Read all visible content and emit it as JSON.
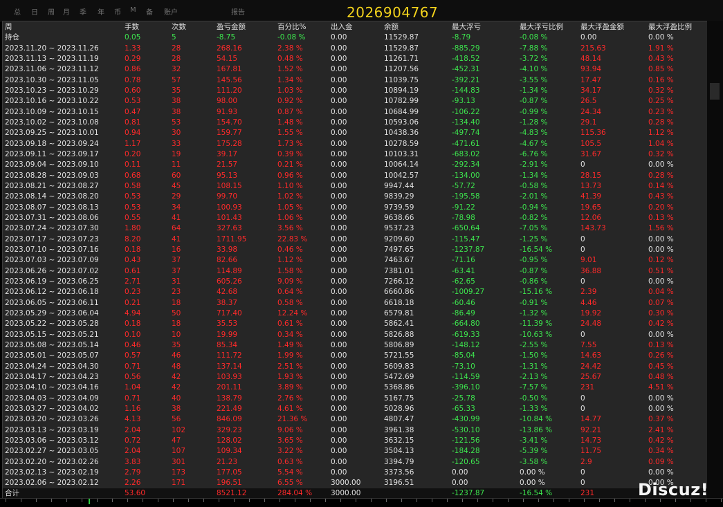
{
  "toolbar": {
    "tabs": [
      "总",
      "日",
      "周",
      "月",
      "季",
      "年",
      "币",
      "M",
      "备",
      "账户",
      "报告"
    ]
  },
  "watermark_id": "2026904767",
  "logo": "Discuz!",
  "table": {
    "columns": [
      "周",
      "手数",
      "次数",
      "盈亏金额",
      "百分比%",
      "出入金",
      "余额",
      "最大浮亏",
      "最大浮亏比例",
      "最大浮盈金额",
      "最大浮盈比例"
    ],
    "holding": [
      "持仓",
      "0.05",
      "5",
      "-8.75",
      "-0.08 %",
      "0.00",
      "11529.87",
      "-8.79",
      "-0.08 %",
      "0.00",
      "0.00 %"
    ],
    "rows": [
      [
        "2023.11.20 ~ 2023.11.26",
        "1.33",
        "28",
        "268.16",
        "2.38 %",
        "0.00",
        "11529.87",
        "-885.29",
        "-7.88 %",
        "215.63",
        "1.91 %"
      ],
      [
        "2023.11.13 ~ 2023.11.19",
        "0.29",
        "28",
        "54.15",
        "0.48 %",
        "0.00",
        "11261.71",
        "-418.52",
        "-3.72 %",
        "48.14",
        "0.43 %"
      ],
      [
        "2023.11.06 ~ 2023.11.12",
        "0.86",
        "32",
        "167.81",
        "1.52 %",
        "0.00",
        "11207.56",
        "-452.31",
        "-4.10 %",
        "93.94",
        "0.85 %"
      ],
      [
        "2023.10.30 ~ 2023.11.05",
        "0.78",
        "57",
        "145.56",
        "1.34 %",
        "0.00",
        "11039.75",
        "-392.21",
        "-3.55 %",
        "17.47",
        "0.16 %"
      ],
      [
        "2023.10.23 ~ 2023.10.29",
        "0.60",
        "35",
        "111.20",
        "1.03 %",
        "0.00",
        "10894.19",
        "-144.83",
        "-1.34 %",
        "34.17",
        "0.32 %"
      ],
      [
        "2023.10.16 ~ 2023.10.22",
        "0.53",
        "38",
        "98.00",
        "0.92 %",
        "0.00",
        "10782.99",
        "-93.13",
        "-0.87 %",
        "26.5",
        "0.25 %"
      ],
      [
        "2023.10.09 ~ 2023.10.15",
        "0.47",
        "38",
        "91.93",
        "0.87 %",
        "0.00",
        "10684.99",
        "-106.22",
        "-0.99 %",
        "24.34",
        "0.23 %"
      ],
      [
        "2023.10.02 ~ 2023.10.08",
        "0.81",
        "53",
        "154.70",
        "1.48 %",
        "0.00",
        "10593.06",
        "-134.40",
        "-1.28 %",
        "29.1",
        "0.28 %"
      ],
      [
        "2023.09.25 ~ 2023.10.01",
        "0.94",
        "30",
        "159.77",
        "1.55 %",
        "0.00",
        "10438.36",
        "-497.74",
        "-4.83 %",
        "115.36",
        "1.12 %"
      ],
      [
        "2023.09.18 ~ 2023.09.24",
        "1.17",
        "33",
        "175.28",
        "1.73 %",
        "0.00",
        "10278.59",
        "-471.61",
        "-4.67 %",
        "105.5",
        "1.04 %"
      ],
      [
        "2023.09.11 ~ 2023.09.17",
        "0.20",
        "19",
        "39.17",
        "0.39 %",
        "0.00",
        "10103.31",
        "-683.02",
        "-6.76 %",
        "31.67",
        "0.32 %"
      ],
      [
        "2023.09.04 ~ 2023.09.10",
        "0.11",
        "11",
        "21.57",
        "0.21 %",
        "0.00",
        "10064.14",
        "-292.34",
        "-2.91 %",
        "0",
        "0.00 %"
      ],
      [
        "2023.08.28 ~ 2023.09.03",
        "0.68",
        "60",
        "95.13",
        "0.96 %",
        "0.00",
        "10042.57",
        "-134.00",
        "-1.34 %",
        "28.15",
        "0.28 %"
      ],
      [
        "2023.08.21 ~ 2023.08.27",
        "0.58",
        "45",
        "108.15",
        "1.10 %",
        "0.00",
        "9947.44",
        "-57.72",
        "-0.58 %",
        "13.73",
        "0.14 %"
      ],
      [
        "2023.08.14 ~ 2023.08.20",
        "0.53",
        "29",
        "99.70",
        "1.02 %",
        "0.00",
        "9839.29",
        "-195.58",
        "-2.01 %",
        "41.39",
        "0.43 %"
      ],
      [
        "2023.08.07 ~ 2023.08.13",
        "0.53",
        "34",
        "100.93",
        "1.05 %",
        "0.00",
        "9739.59",
        "-91.22",
        "-0.94 %",
        "19.65",
        "0.20 %"
      ],
      [
        "2023.07.31 ~ 2023.08.06",
        "0.55",
        "41",
        "101.43",
        "1.06 %",
        "0.00",
        "9638.66",
        "-78.98",
        "-0.82 %",
        "12.06",
        "0.13 %"
      ],
      [
        "2023.07.24 ~ 2023.07.30",
        "1.80",
        "64",
        "327.63",
        "3.56 %",
        "0.00",
        "9537.23",
        "-650.64",
        "-7.05 %",
        "143.73",
        "1.56 %"
      ],
      [
        "2023.07.17 ~ 2023.07.23",
        "8.20",
        "41",
        "1711.95",
        "22.83 %",
        "0.00",
        "9209.60",
        "-115.47",
        "-1.25 %",
        "0",
        "0.00 %"
      ],
      [
        "2023.07.10 ~ 2023.07.16",
        "0.18",
        "16",
        "33.98",
        "0.46 %",
        "0.00",
        "7497.65",
        "-1237.87",
        "-16.54 %",
        "0",
        "0.00 %"
      ],
      [
        "2023.07.03 ~ 2023.07.09",
        "0.43",
        "37",
        "82.66",
        "1.12 %",
        "0.00",
        "7463.67",
        "-71.16",
        "-0.95 %",
        "9.01",
        "0.12 %"
      ],
      [
        "2023.06.26 ~ 2023.07.02",
        "0.61",
        "37",
        "114.89",
        "1.58 %",
        "0.00",
        "7381.01",
        "-63.41",
        "-0.87 %",
        "36.88",
        "0.51 %"
      ],
      [
        "2023.06.19 ~ 2023.06.25",
        "2.71",
        "31",
        "605.26",
        "9.09 %",
        "0.00",
        "7266.12",
        "-62.65",
        "-0.86 %",
        "0",
        "0.00 %"
      ],
      [
        "2023.06.12 ~ 2023.06.18",
        "0.23",
        "23",
        "42.68",
        "0.64 %",
        "0.00",
        "6660.86",
        "-1009.27",
        "-15.16 %",
        "2.39",
        "0.04 %"
      ],
      [
        "2023.06.05 ~ 2023.06.11",
        "0.21",
        "18",
        "38.37",
        "0.58 %",
        "0.00",
        "6618.18",
        "-60.46",
        "-0.91 %",
        "4.46",
        "0.07 %"
      ],
      [
        "2023.05.29 ~ 2023.06.04",
        "4.94",
        "50",
        "717.40",
        "12.24 %",
        "0.00",
        "6579.81",
        "-86.49",
        "-1.32 %",
        "19.92",
        "0.30 %"
      ],
      [
        "2023.05.22 ~ 2023.05.28",
        "0.18",
        "18",
        "35.53",
        "0.61 %",
        "0.00",
        "5862.41",
        "-664.80",
        "-11.39 %",
        "24.48",
        "0.42 %"
      ],
      [
        "2023.05.15 ~ 2023.05.21",
        "0.10",
        "10",
        "19.99",
        "0.34 %",
        "0.00",
        "5826.88",
        "-619.33",
        "-10.63 %",
        "0",
        "0.00 %"
      ],
      [
        "2023.05.08 ~ 2023.05.14",
        "0.46",
        "35",
        "85.34",
        "1.49 %",
        "0.00",
        "5806.89",
        "-148.12",
        "-2.55 %",
        "7.55",
        "0.13 %"
      ],
      [
        "2023.05.01 ~ 2023.05.07",
        "0.57",
        "46",
        "111.72",
        "1.99 %",
        "0.00",
        "5721.55",
        "-85.04",
        "-1.50 %",
        "14.63",
        "0.26 %"
      ],
      [
        "2023.04.24 ~ 2023.04.30",
        "0.71",
        "48",
        "137.14",
        "2.51 %",
        "0.00",
        "5609.83",
        "-73.10",
        "-1.31 %",
        "24.42",
        "0.45 %"
      ],
      [
        "2023.04.17 ~ 2023.04.23",
        "0.56",
        "42",
        "103.93",
        "1.93 %",
        "0.00",
        "5472.69",
        "-114.59",
        "-2.13 %",
        "25.67",
        "0.48 %"
      ],
      [
        "2023.04.10 ~ 2023.04.16",
        "1.04",
        "42",
        "201.11",
        "3.89 %",
        "0.00",
        "5368.86",
        "-396.10",
        "-7.57 %",
        "231",
        "4.51 %"
      ],
      [
        "2023.04.03 ~ 2023.04.09",
        "0.71",
        "40",
        "138.79",
        "2.76 %",
        "0.00",
        "5167.75",
        "-25.78",
        "-0.50 %",
        "0",
        "0.00 %"
      ],
      [
        "2023.03.27 ~ 2023.04.02",
        "1.16",
        "38",
        "221.49",
        "4.61 %",
        "0.00",
        "5028.96",
        "-65.33",
        "-1.33 %",
        "0",
        "0.00 %"
      ],
      [
        "2023.03.20 ~ 2023.03.26",
        "4.13",
        "56",
        "846.09",
        "21.36 %",
        "0.00",
        "4807.47",
        "-430.99",
        "-10.84 %",
        "14.77",
        "0.37 %"
      ],
      [
        "2023.03.13 ~ 2023.03.19",
        "2.04",
        "102",
        "329.23",
        "9.06 %",
        "0.00",
        "3961.38",
        "-530.10",
        "-13.86 %",
        "92.21",
        "2.41 %"
      ],
      [
        "2023.03.06 ~ 2023.03.12",
        "0.72",
        "47",
        "128.02",
        "3.65 %",
        "0.00",
        "3632.15",
        "-121.56",
        "-3.41 %",
        "14.73",
        "0.42 %"
      ],
      [
        "2023.02.27 ~ 2023.03.05",
        "2.04",
        "107",
        "109.34",
        "3.22 %",
        "0.00",
        "3504.13",
        "-184.28",
        "-5.39 %",
        "11.75",
        "0.34 %"
      ],
      [
        "2023.02.20 ~ 2023.02.26",
        "3.83",
        "301",
        "21.23",
        "0.63 %",
        "0.00",
        "3394.79",
        "-120.65",
        "-3.58 %",
        "2.9",
        "0.09 %"
      ],
      [
        "2023.02.13 ~ 2023.02.19",
        "2.79",
        "173",
        "177.05",
        "5.54 %",
        "0.00",
        "3373.56",
        "0.00",
        "0.00 %",
        "0",
        "0.00 %"
      ],
      [
        "2023.02.06 ~ 2023.02.12",
        "2.26",
        "171",
        "196.51",
        "6.55 %",
        "3000.00",
        "3196.51",
        "0.00",
        "0.00 %",
        "0",
        "0.00 %"
      ]
    ],
    "total": [
      "合计",
      "53.60",
      "",
      "8521.12",
      "284.04 %",
      "3000.00",
      "",
      "-1237.87",
      "-16.54 %",
      "231",
      ""
    ]
  },
  "colors": {
    "positive": "#ff2a2a",
    "negative": "#3de44e",
    "neutral": "#e0e0e0",
    "panel": "#262626",
    "accent_id": "#f3d21c"
  }
}
